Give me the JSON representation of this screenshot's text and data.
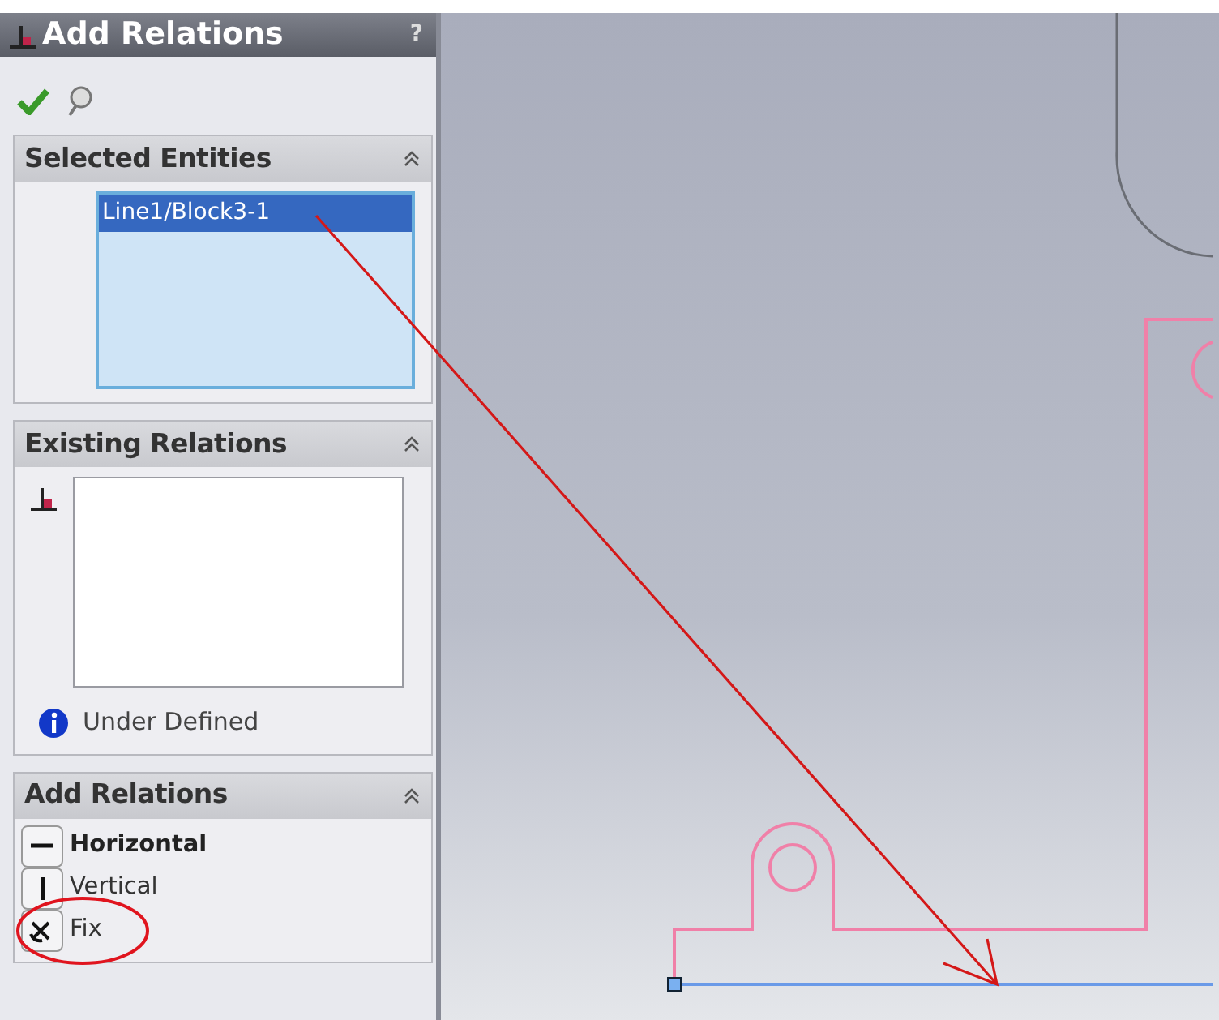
{
  "panel": {
    "title": "Add Relations",
    "help": "?"
  },
  "toolbar": [
    {
      "kind": "ok"
    },
    {
      "kind": "pin"
    }
  ],
  "selected_entities": {
    "title": "Selected Entities",
    "expanded": true,
    "items": [
      {
        "label": "Line1/Block3-1",
        "selected": true
      }
    ]
  },
  "existing_relations": {
    "title": "Existing Relations",
    "expanded": true,
    "status": "Under Defined"
  },
  "add_relations": {
    "title": "Add Relations",
    "expanded": true,
    "items": [
      {
        "label": "Horizontal",
        "kind": "horizontal",
        "highlighted": true,
        "circled": false
      },
      {
        "label": "Vertical",
        "kind": "vertical",
        "highlighted": false,
        "circled": false
      },
      {
        "label": "Fix",
        "kind": "fix",
        "highlighted": false,
        "circled": true
      }
    ]
  }
}
